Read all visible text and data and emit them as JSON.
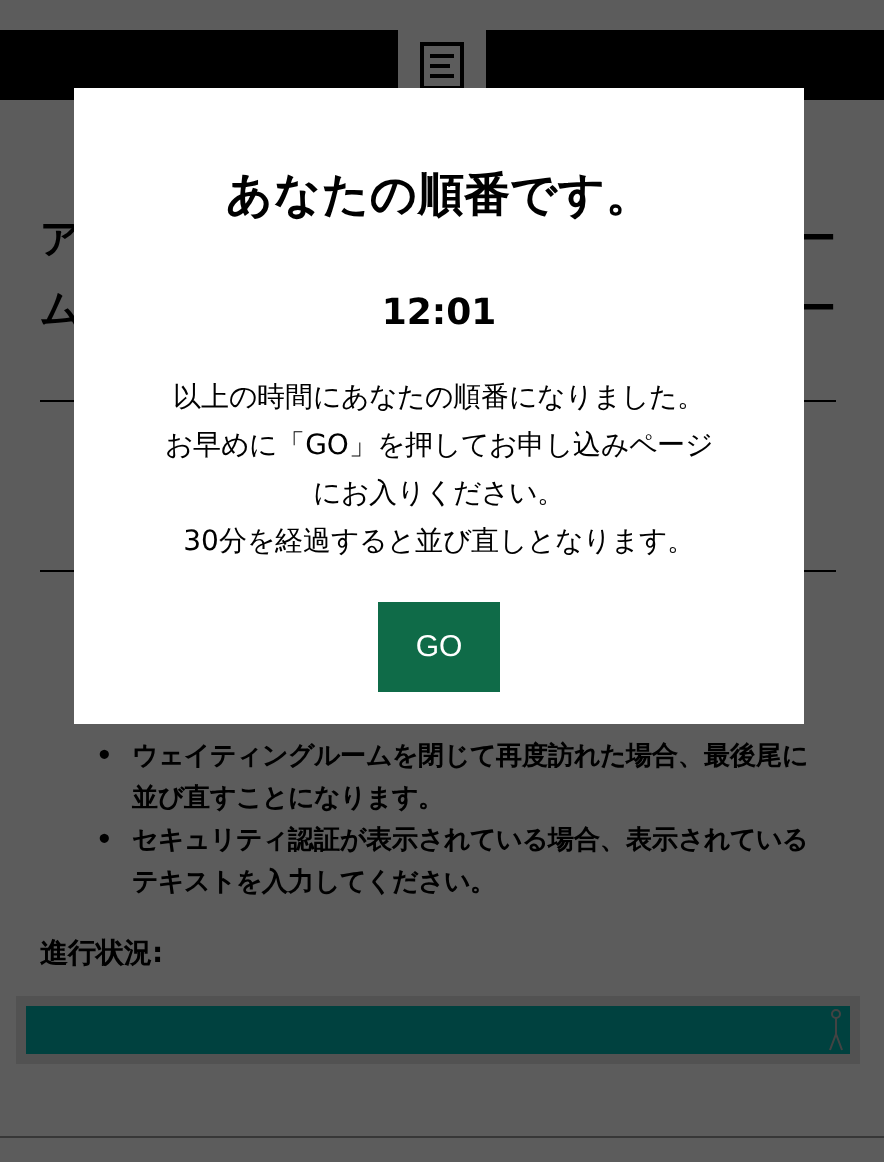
{
  "page": {
    "heading_lines": [
      {
        "start": "ア",
        "end": "ー"
      },
      {
        "start": "ム",
        "end": "ー"
      }
    ],
    "notes": [
      {
        "bullet": "•",
        "text": "ウェイティングルームを閉じて再度訪れた場合、最後尾に並び直すことになります。"
      },
      {
        "bullet": "•",
        "text": "セキュリティ認証が表示されている場合、表示されているテキストを入力してください。"
      }
    ],
    "progress": {
      "label": "進行状況:",
      "level": 1.0
    }
  },
  "modal": {
    "title": "あなたの順番です。",
    "time": "12:01",
    "message": [
      "以上の時間にあなたの順番になりました。",
      "お早めに「GO」を押してお申し込みページ",
      "にお入りください。",
      "30分を経過すると並び直しとなります。"
    ],
    "button": "GO"
  }
}
